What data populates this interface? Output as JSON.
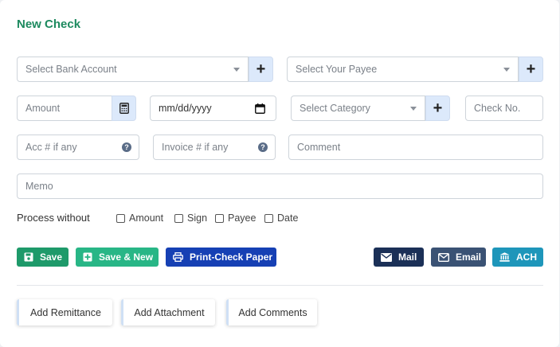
{
  "form": {
    "title": "New Check",
    "bank_account_placeholder": "Select Bank Account",
    "payee_placeholder": "Select Your Payee",
    "amount_placeholder": "Amount",
    "date_placeholder": "mm/dd/yyyy",
    "category_placeholder": "Select Category",
    "check_no_placeholder": "Check No.",
    "acc_placeholder": "Acc # if any",
    "invoice_placeholder": "Invoice # if any",
    "comment_placeholder": "Comment",
    "memo_placeholder": "Memo",
    "process_without_label": "Process without",
    "options": {
      "amount": "Amount",
      "sign": "Sign",
      "payee": "Payee",
      "date": "Date"
    }
  },
  "actions": {
    "save": "Save",
    "save_new": "Save & New",
    "print": "Print-Check Paper",
    "mail": "Mail",
    "email": "Email",
    "ach": "ACH"
  },
  "extras": {
    "remittance": "Add Remittance",
    "attachment": "Add Attachment",
    "comments": "Add Comments"
  },
  "colors": {
    "title": "#1d8a5f",
    "save": "#1e9a6a",
    "save_new": "#28b686",
    "print": "#1640b4",
    "mail": "#1b3057",
    "email": "#3a5274",
    "ach": "#1e96ba",
    "addon": "#dce9fb"
  }
}
